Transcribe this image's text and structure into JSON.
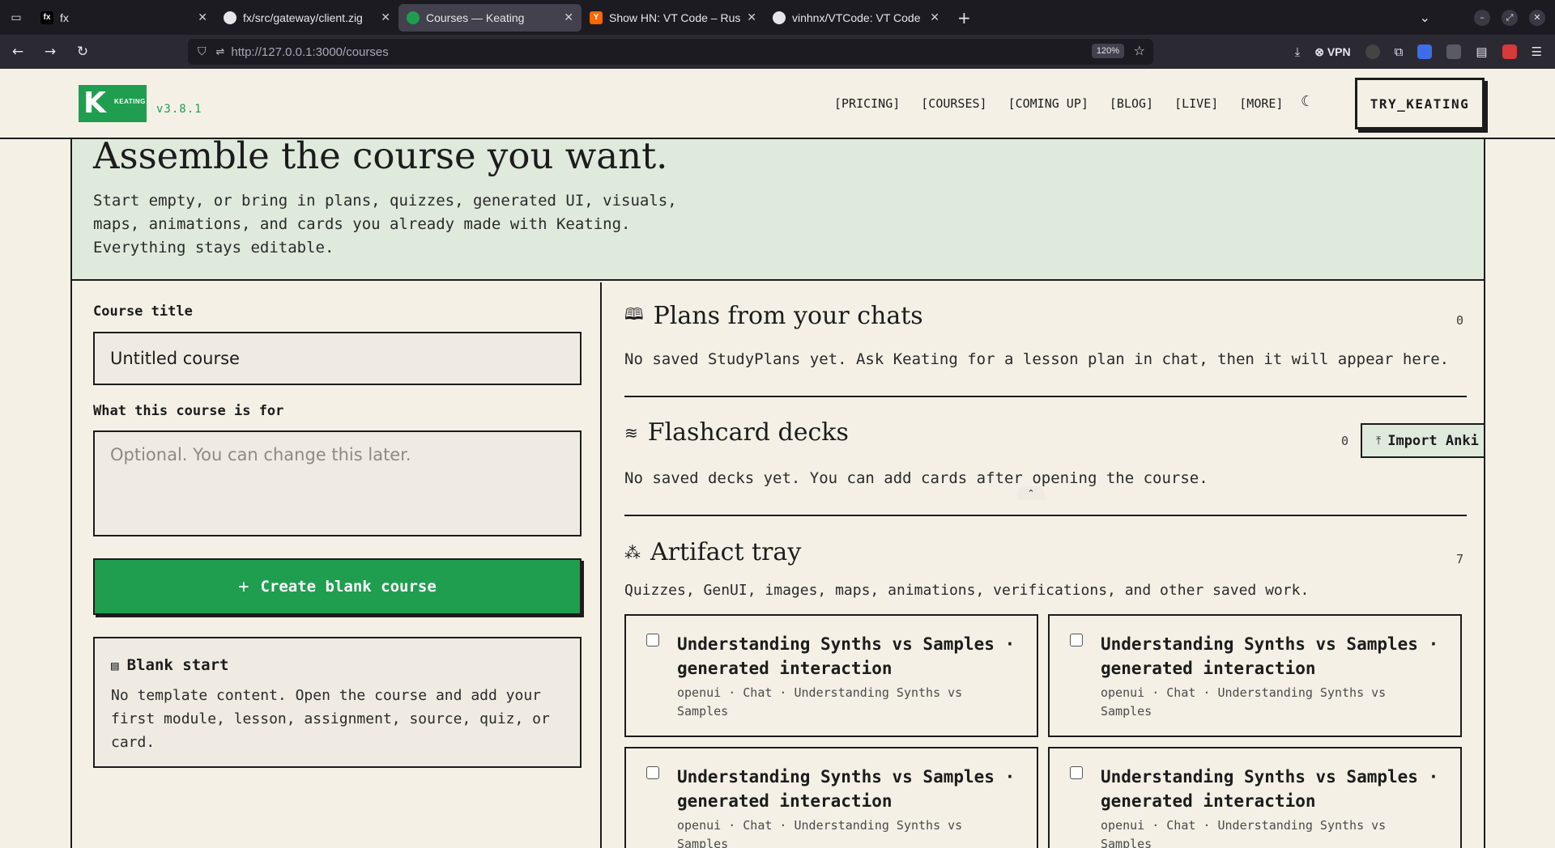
{
  "browser": {
    "tabs": [
      {
        "title": "fx",
        "favicon": "fx-icon",
        "favicon_text": "fx",
        "active": false
      },
      {
        "title": "fx/src/gateway/client.zig",
        "favicon": "github-icon",
        "active": false
      },
      {
        "title": "Courses — Keating",
        "favicon": "keating-icon",
        "active": true
      },
      {
        "title": "Show HN: VT Code – Rust",
        "favicon": "hackernews-icon",
        "favicon_text": "Y",
        "active": false
      },
      {
        "title": "vinhnx/VTCode: VT Code",
        "favicon": "github-icon",
        "active": false
      }
    ],
    "url": "http://127.0.0.1:3000/courses",
    "zoom": "120%",
    "vpn_label": "VPN"
  },
  "header": {
    "logo_text": "KEATING",
    "version": "v3.8.1",
    "nav": [
      "[PRICING]",
      "[COURSES]",
      "[COMING UP]",
      "[BLOG]",
      "[LIVE]",
      "[MORE]"
    ],
    "try_label": "TRY_KEATING"
  },
  "hero": {
    "title": "Assemble the course you want.",
    "description": "Start empty, or bring in plans, quizzes, generated UI, visuals, maps, animations, and cards you already made with Keating. Everything stays editable."
  },
  "form": {
    "title_label": "Course title",
    "title_value": "Untitled course",
    "purpose_label": "What this course is for",
    "purpose_placeholder": "Optional. You can change this later.",
    "create_label": "Create blank course",
    "blank_start": {
      "title": "Blank start",
      "description": "No template content. Open the course and add your first module, lesson, assignment, source, quiz, or card."
    }
  },
  "plans": {
    "title": "Plans from your chats",
    "count": "0",
    "empty": "No saved StudyPlans yet. Ask Keating for a lesson plan in chat, then it will appear here."
  },
  "decks": {
    "title": "Flashcard decks",
    "count": "0",
    "import_label": "Import Anki file",
    "empty": "No saved decks yet. You can add cards after opening the course."
  },
  "artifacts": {
    "title": "Artifact tray",
    "count": "7",
    "description": "Quizzes, GenUI, images, maps, animations, verifications, and other saved work.",
    "items": [
      {
        "title": "Understanding Synths vs Samples · generated interaction",
        "meta": "openui · Chat · Understanding Synths vs Samples"
      },
      {
        "title": "Understanding Synths vs Samples · generated interaction",
        "meta": "openui · Chat · Understanding Synths vs Samples"
      },
      {
        "title": "Understanding Synths vs Samples · generated interaction",
        "meta": "openui · Chat · Understanding Synths vs Samples"
      },
      {
        "title": "Understanding Synths vs Samples · generated interaction",
        "meta": "openui · Chat · Understanding Synths vs Samples"
      }
    ]
  },
  "colors": {
    "brand_green": "#1f9e4f",
    "background": "#f4f0e6",
    "hero_bg": "#dfe9dc"
  }
}
